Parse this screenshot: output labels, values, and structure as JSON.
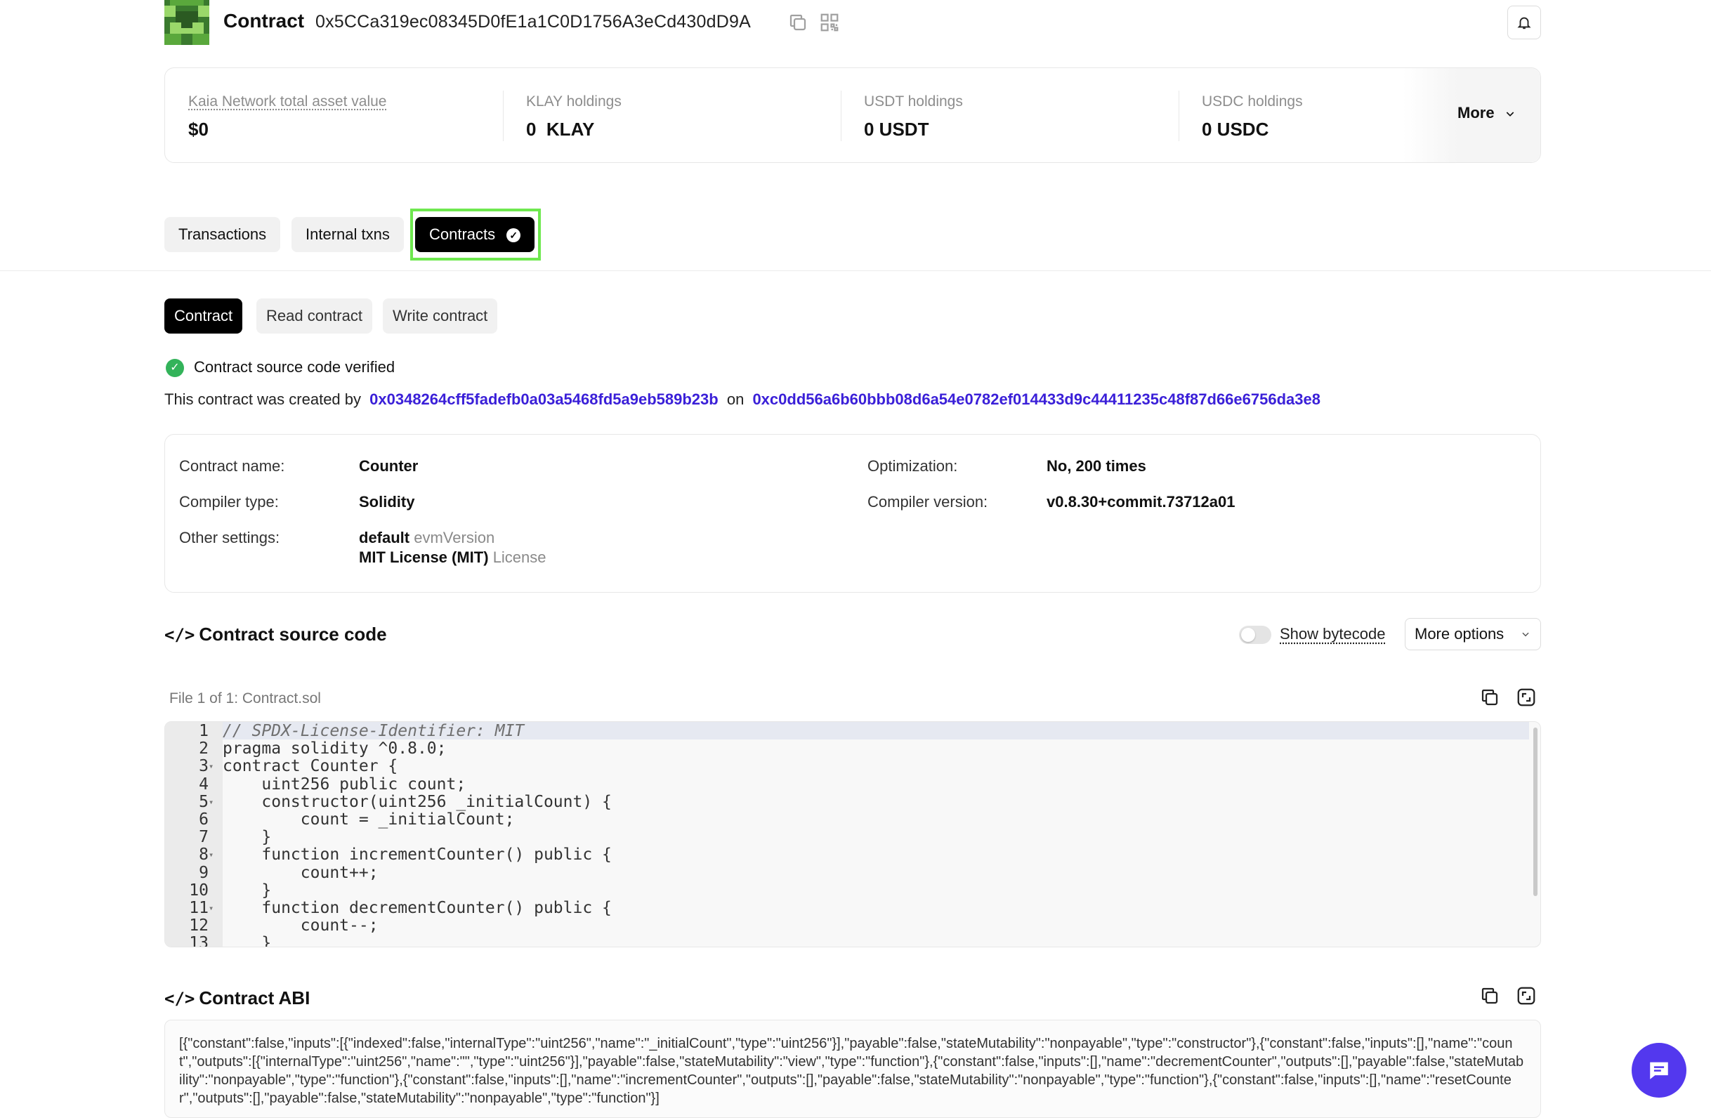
{
  "header": {
    "title": "Contract",
    "address": "0x5CCa319ec08345D0fE1a1C0D1756A3eCd430dD9A"
  },
  "summary": {
    "total_label": "Kaia Network total asset value",
    "total_value": "$0",
    "klay_label": "KLAY holdings",
    "klay_value": "0  KLAY",
    "usdt_label": "USDT holdings",
    "usdt_value": "0 USDT",
    "usdc_label": "USDC holdings",
    "usdc_value": "0 USDC",
    "more_label": "More"
  },
  "tabs": [
    {
      "label": "Transactions"
    },
    {
      "label": "Internal txns"
    },
    {
      "label": "Contracts",
      "active": true
    }
  ],
  "subtabs": [
    {
      "label": "Contract",
      "active": true
    },
    {
      "label": "Read contract"
    },
    {
      "label": "Write contract"
    }
  ],
  "verified_text": "Contract source code verified",
  "created": {
    "prefix": "This contract was created by",
    "creator": "0x0348264cff5fadefb0a03a5468fd5a9eb589b23b",
    "on": "on",
    "tx": "0xc0dd56a6b60bbb08d6a54e0782ef014433d9c44411235c48f87d66e6756da3e8"
  },
  "info": {
    "name_label": "Contract name:",
    "name_value": "Counter",
    "compiler_type_label": "Compiler type:",
    "compiler_type_value": "Solidity",
    "other_label": "Other settings:",
    "evm_value": "default",
    "evm_suffix": "evmVersion",
    "license_value": "MIT License (MIT)",
    "license_suffix": "License",
    "optimization_label": "Optimization:",
    "optimization_value": "No, 200 times",
    "compiler_version_label": "Compiler version:",
    "compiler_version_value": "v0.8.30+commit.73712a01"
  },
  "source": {
    "title": "Contract source code",
    "show_bytecode": "Show bytecode",
    "more_options": "More options",
    "file_label": "File 1 of 1: Contract.sol",
    "lines": [
      "// SPDX-License-Identifier: MIT",
      "pragma solidity ^0.8.0;",
      "contract Counter {",
      "    uint256 public count;",
      "    constructor(uint256 _initialCount) {",
      "        count = _initialCount;",
      "    }",
      "    function incrementCounter() public {",
      "        count++;",
      "    }",
      "    function decrementCounter() public {",
      "        count--;",
      "    }"
    ],
    "line_numbers": [
      "1",
      "2",
      "3",
      "4",
      "5",
      "6",
      "7",
      "8",
      "9",
      "10",
      "11",
      "12",
      "13"
    ]
  },
  "abi": {
    "title": "Contract ABI",
    "text": "[{\"constant\":false,\"inputs\":[{\"indexed\":false,\"internalType\":\"uint256\",\"name\":\"_initialCount\",\"type\":\"uint256\"}],\"payable\":false,\"stateMutability\":\"nonpayable\",\"type\":\"constructor\"},{\"constant\":false,\"inputs\":[],\"name\":\"count\",\"outputs\":[{\"internalType\":\"uint256\",\"name\":\"\",\"type\":\"uint256\"}],\"payable\":false,\"stateMutability\":\"view\",\"type\":\"function\"},{\"constant\":false,\"inputs\":[],\"name\":\"decrementCounter\",\"outputs\":[],\"payable\":false,\"stateMutability\":\"nonpayable\",\"type\":\"function\"},{\"constant\":false,\"inputs\":[],\"name\":\"incrementCounter\",\"outputs\":[],\"payable\":false,\"stateMutability\":\"nonpayable\",\"type\":\"function\"},{\"constant\":false,\"inputs\":[],\"name\":\"resetCounter\",\"outputs\":[],\"payable\":false,\"stateMutability\":\"nonpayable\",\"type\":\"function\"}]"
  },
  "colors": {
    "accent_link": "#3a1fd8",
    "verified_green": "#33b35a",
    "highlight_outline": "#6ee84f",
    "chat_button": "#5338ee"
  },
  "icons": [
    "copy-icon",
    "qr-code-icon",
    "bell-icon",
    "chevron-down-icon",
    "check-circle-icon",
    "code-icon",
    "expand-icon",
    "chat-icon"
  ]
}
